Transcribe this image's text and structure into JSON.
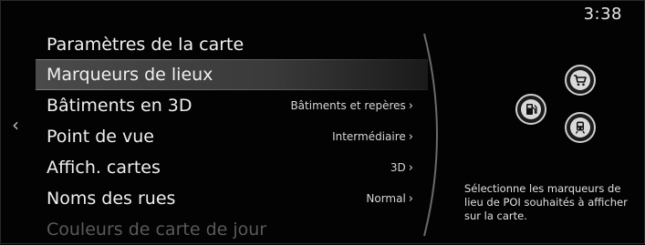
{
  "status": {
    "clock": "3:38"
  },
  "nav": {
    "back_glyph": "‹"
  },
  "menu": {
    "title": "Paramètres de la carte",
    "items": [
      {
        "label": "Marqueurs de lieux",
        "value": ""
      },
      {
        "label": "Bâtiments en 3D",
        "value": "Bâtiments et repères"
      },
      {
        "label": "Point de vue",
        "value": "Intermédiaire"
      },
      {
        "label": "Affich. cartes",
        "value": "3D"
      },
      {
        "label": "Noms des rues",
        "value": "Normal"
      },
      {
        "label": "Couleurs de carte de jour",
        "value": ""
      }
    ],
    "selected_index": 0
  },
  "poi_icons": [
    {
      "name": "cart-icon"
    },
    {
      "name": "fuel-icon"
    },
    {
      "name": "train-icon"
    }
  ],
  "help": {
    "text": "Sélectionne les marqueurs de lieu de POI souhaités à afficher sur la carte."
  },
  "colors": {
    "background": "#030303",
    "text": "#efefef",
    "highlight": "#4a4a4a"
  }
}
